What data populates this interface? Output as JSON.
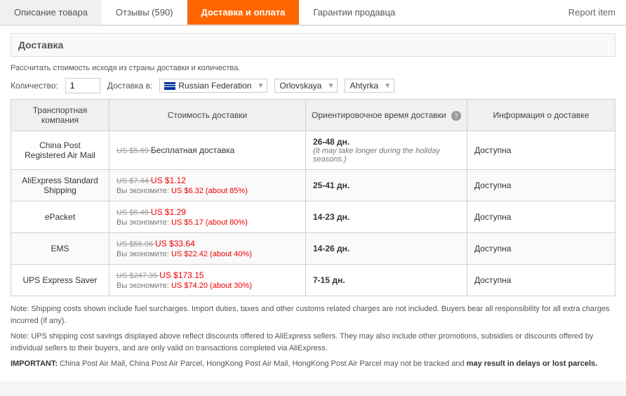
{
  "tabs": [
    {
      "id": "description",
      "label": "Описание товара",
      "active": false
    },
    {
      "id": "reviews",
      "label": "Отзывы (590)",
      "active": false
    },
    {
      "id": "shipping",
      "label": "Доставка и оплата",
      "active": true
    },
    {
      "id": "guarantee",
      "label": "Гарантии продавца",
      "active": false
    }
  ],
  "report_item": "Report item",
  "section_title": "Доставка",
  "calc_note": "Рассчитать стоимость исходя из страны доставки и количества.",
  "quantity_label": "Количество:",
  "quantity_value": "1",
  "delivery_label": "Доставка в:",
  "country": "Russian Federation",
  "region": "Orlovskaya",
  "city": "Ahtyrka",
  "table": {
    "headers": [
      "Транспортная компания",
      "Стоимость доставки",
      "Ориентировочное время доставки",
      "Информация о доставке"
    ],
    "rows": [
      {
        "carrier": "China Post Registered Air Mail",
        "original_price": "US $5.69",
        "discount_price": "",
        "free": "Бесплатная доставка",
        "savings": "",
        "time_main": "26-48 дн.",
        "time_note": "(It may take longer during the holiday seasons.)",
        "info": "Доступна"
      },
      {
        "carrier": "AliExpress Standard Shipping",
        "original_price": "US $7.44",
        "discount_price": "US $1.12",
        "free": "",
        "savings": "Вы экономите: US $6.32 (about 85%)",
        "time_main": "25-41 дн.",
        "time_note": "",
        "info": "Доступна"
      },
      {
        "carrier": "ePacket",
        "original_price": "US $6.46",
        "discount_price": "US $1.29",
        "free": "",
        "savings": "Вы экономите: US $5.17 (about 80%)",
        "time_main": "14-23 дн.",
        "time_note": "",
        "info": "Доступна"
      },
      {
        "carrier": "EMS",
        "original_price": "US $56.06",
        "discount_price": "US $33.64",
        "free": "",
        "savings": "Вы экономите: US $22.42 (about 40%)",
        "time_main": "14-26 дн.",
        "time_note": "",
        "info": "Доступна"
      },
      {
        "carrier": "UPS Express Saver",
        "original_price": "US $247.35",
        "discount_price": "US $173.15",
        "free": "",
        "savings": "Вы экономите: US $74.20 (about 30%)",
        "time_main": "7-15 дн.",
        "time_note": "",
        "info": "Доступна"
      }
    ]
  },
  "notes": {
    "note1": "Note: Shipping costs shown include fuel surcharges. Import duties, taxes and other customs related charges are not included. Buyers bear all responsibility for all extra charges incurred (if any).",
    "note2": "Note: UPS shipping cost savings displayed above reflect discounts offered to AliExpress sellers. They may also include other promotions, subsidies or discounts offered by individual sellers to their buyers, and are only valid on transactions completed via AliExpress.",
    "note3_prefix": "IMPORTANT: China Post Air Mail, China Post Air Parcel, HongKong Post Air Mail, HongKong Post Air Parcel may not be tracked and ",
    "note3_bold": "may result in delays or lost parcels."
  }
}
